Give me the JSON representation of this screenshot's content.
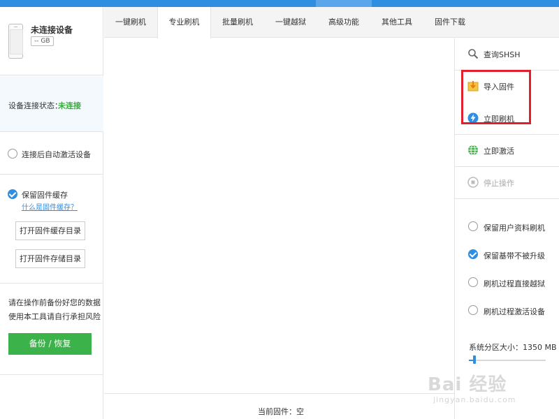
{
  "device": {
    "name": "未连接设备",
    "size": "-- GB",
    "status_label": "设备连接状态：",
    "status_value": "未连接"
  },
  "left": {
    "auto_activate_label": "连接后自动激活设备",
    "keep_cache_label": "保留固件缓存",
    "cache_link": "什么是固件缓存？",
    "open_cache_dir": "打开固件缓存目录",
    "open_storage_dir": "打开固件存储目录",
    "warning_line1": "请在操作前备份好您的数据",
    "warning_line2": "使用本工具请自行承担风险",
    "backup_button": "备份 / 恢复"
  },
  "tabs": [
    {
      "label": "一键刷机"
    },
    {
      "label": "专业刷机"
    },
    {
      "label": "批量刷机"
    },
    {
      "label": "一键越狱"
    },
    {
      "label": "高级功能"
    },
    {
      "label": "其他工具"
    },
    {
      "label": "固件下载"
    }
  ],
  "active_tab": "专业刷机",
  "main": {
    "current_firmware": "当前固件：空"
  },
  "right": {
    "actions": [
      {
        "label": "查询SHSH",
        "icon": "magnifier-icon",
        "enabled": true
      },
      {
        "label": "导入固件",
        "icon": "import-folder-icon",
        "enabled": true
      },
      {
        "label": "立即刷机",
        "icon": "lightning-icon",
        "enabled": true
      },
      {
        "label": "立即激活",
        "icon": "globe-icon",
        "enabled": true
      },
      {
        "label": "停止操作",
        "icon": "stop-icon",
        "enabled": false
      }
    ],
    "options": [
      {
        "label": "保留用户资料刷机",
        "checked": false
      },
      {
        "label": "保留基带不被升级",
        "checked": true
      },
      {
        "label": "刷机过程直接越狱",
        "checked": false
      },
      {
        "label": "刷机过程激活设备",
        "checked": false
      }
    ],
    "system_partition_label": "系统分区大小：1350 MB"
  },
  "colors": {
    "accent": "#2f8ee0",
    "success": "#3bab3e",
    "button_green": "#3cb24a",
    "highlight_red": "#e0202c"
  },
  "watermark": {
    "main": "Bai 经验",
    "sub": "jingyan.baidu.com"
  }
}
